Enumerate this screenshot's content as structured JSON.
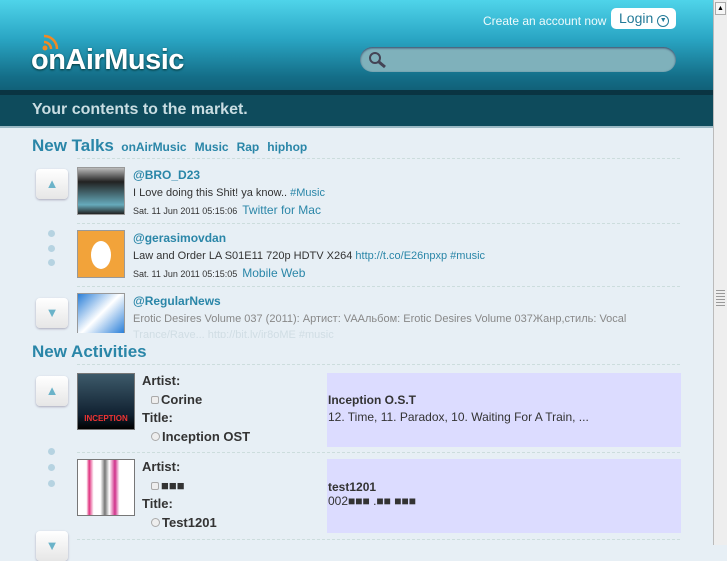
{
  "header": {
    "logo": "onAirMusic",
    "create_account": "Create an account now",
    "login": "Login",
    "tagline": "Your contents to the market.",
    "search_placeholder": ""
  },
  "talks": {
    "title": "New Talks",
    "tags": [
      "onAirMusic",
      "Music",
      "Rap",
      "hiphop"
    ],
    "items": [
      {
        "user": "@BRO_D23",
        "text": "I Love doing this Shit! ya know.. ",
        "link": "#Music",
        "date": "Sat. 11 Jun 2011 05:15:06",
        "source": "Twitter for Mac"
      },
      {
        "user": "@gerasimovdan",
        "text": "Law and Order LA S01E11 720p HDTV X264 ",
        "link": "http://t.co/E26npxp #music",
        "date": "Sat. 11 Jun 2011 05:15:05",
        "source": "Mobile Web"
      },
      {
        "user": "@RegularNews",
        "text": "Erotic Desires Volume 037 (2011): Артист: VAАльбом: Erotic Desires Volume 037Жанр,стиль: Vocal",
        "text2": "Trance/Rave... http://bit.ly/jr8oME #music"
      }
    ]
  },
  "activities": {
    "title": "New Activities",
    "artist_label": "Artist:",
    "title_label": "Title:",
    "items": [
      {
        "artist": "Corine",
        "title": "Inception OST",
        "album": "Inception O.S.T",
        "tracks": "12. Time, 11. Paradox, 10. Waiting For A Train, ...",
        "cover_text": "INCEPTION"
      },
      {
        "artist": "■■■",
        "title": "Test1201",
        "album": "test1201",
        "tracks": "002■■■ .■■ ■■■"
      }
    ]
  }
}
